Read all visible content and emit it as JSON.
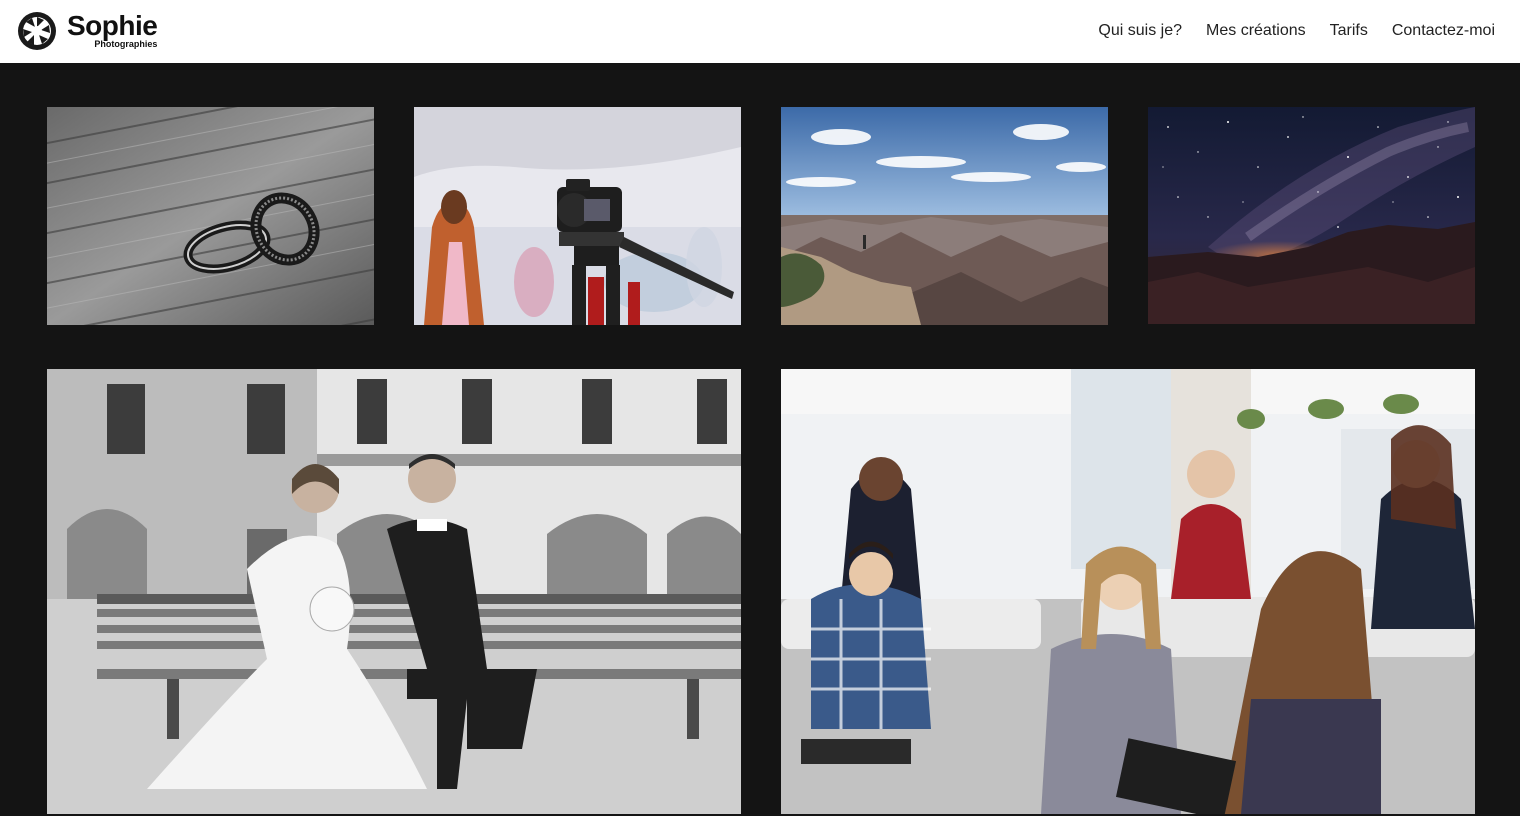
{
  "brand": {
    "name": "Sophie",
    "subtitle": "Photographies",
    "icon": "aperture-icon"
  },
  "nav": {
    "items": [
      {
        "label": "Qui suis je?"
      },
      {
        "label": "Mes créations"
      },
      {
        "label": "Tarifs"
      },
      {
        "label": "Contactez-moi"
      }
    ]
  },
  "gallery": {
    "images": [
      {
        "subject": "wedding-rings-photo"
      },
      {
        "subject": "camera-event-photo"
      },
      {
        "subject": "canyon-landscape-photo"
      },
      {
        "subject": "milky-way-night-photo"
      },
      {
        "subject": "wedding-couple-bench-photo"
      },
      {
        "subject": "office-team-meeting-photo"
      }
    ]
  },
  "colors": {
    "header_bg": "#ffffff",
    "page_bg": "#141414",
    "text": "#222222"
  }
}
